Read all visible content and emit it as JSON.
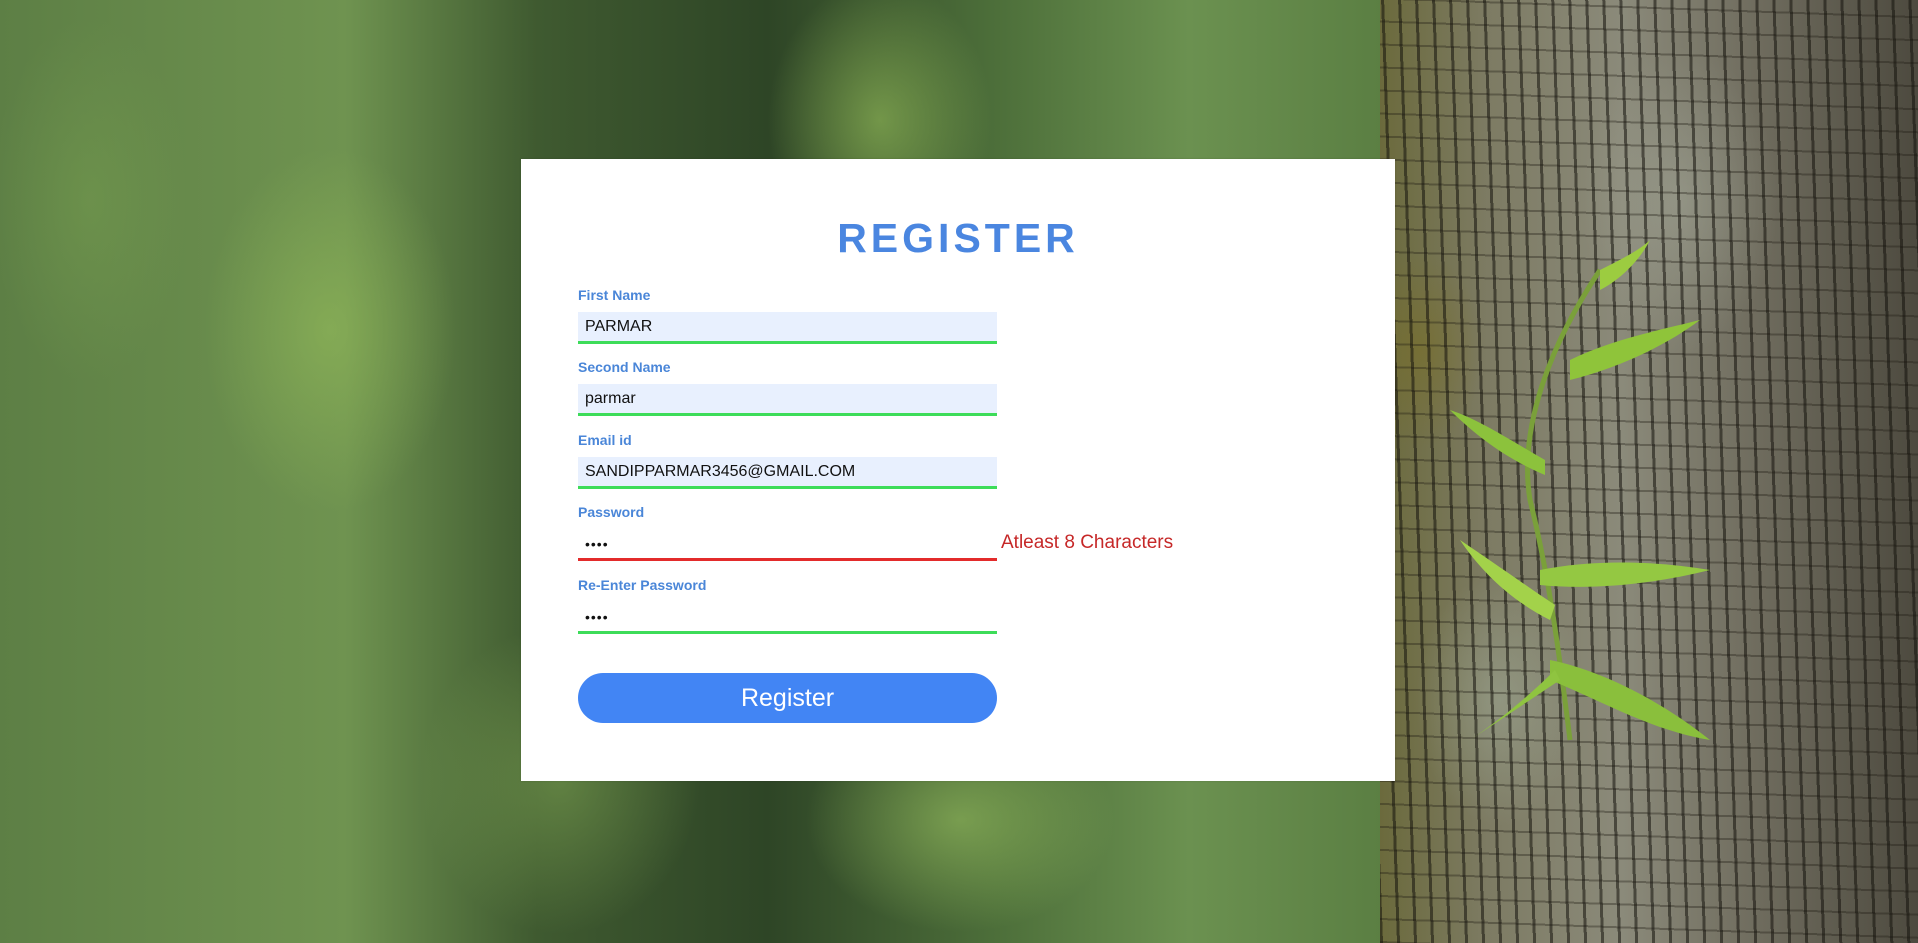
{
  "page": {
    "title": "REGISTER"
  },
  "form": {
    "first_name": {
      "label": "First Name",
      "value": "PARMAR",
      "status": "valid"
    },
    "second_name": {
      "label": "Second Name",
      "value": "parmar",
      "status": "valid"
    },
    "email": {
      "label": "Email id",
      "value": "SANDIPPARMAR3456@GMAIL.COM",
      "status": "valid"
    },
    "password": {
      "label": "Password",
      "masked_value": "••••",
      "status": "invalid",
      "error": "Atleast 8 Characters"
    },
    "reenter_password": {
      "label": "Re-Enter Password",
      "masked_value": "••••",
      "status": "valid"
    },
    "submit_label": "Register"
  },
  "colors": {
    "accent": "#4285f4",
    "label": "#4a86d8",
    "valid_border": "#3ddc59",
    "invalid_border": "#e32b2b",
    "error_text": "#c62828",
    "filled_input_bg": "#e8f0fe"
  }
}
